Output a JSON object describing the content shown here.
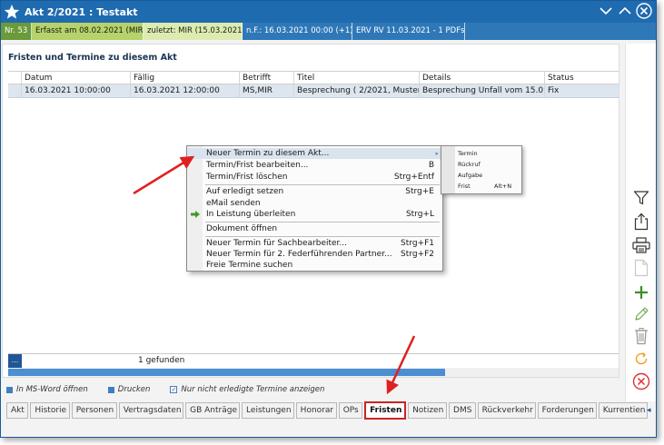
{
  "window": {
    "title": "Akt 2/2021 : Testakt"
  },
  "infobar": [
    {
      "text": "Nr. 53",
      "bg": "#6a9a3a",
      "fg": "#ffffff"
    },
    {
      "text": "Erfasst am 08.02.2021 (MIR)",
      "bg": "#b5d36a",
      "fg": "#1a1a1a"
    },
    {
      "text": "zuletzt: MIR (15.03.2021)",
      "bg": "#dcecb0",
      "fg": "#1a1a1a"
    },
    {
      "text": "n.F.: 16.03.2021 00:00 (+1)",
      "bg": "#2f78b8",
      "fg": "#ffffff"
    },
    {
      "text": "ERV RV 11.03.2021 - 1 PDFs",
      "bg": "#2f78b8",
      "fg": "#ffffff"
    }
  ],
  "section": {
    "title": "Fristen und Termine zu diesem Akt"
  },
  "grid": {
    "columns": [
      "Datum",
      "Fällig",
      "Betrifft",
      "Titel",
      "Details",
      "Status"
    ],
    "rows": [
      [
        "16.03.2021 10:00:00",
        "16.03.2021 12:00:00",
        "MS,MIR",
        "Besprechung ( 2/2021, Muster...",
        "Besprechung Unfall vom 15.0...",
        "Fix"
      ]
    ]
  },
  "footer": {
    "button": "...",
    "count": "1 gefunden"
  },
  "options": {
    "word": "In MS-Word öffnen",
    "print": "Drucken",
    "filter": "Nur nicht erledigte Termine anzeigen"
  },
  "tabs": [
    {
      "label": "Akt"
    },
    {
      "label": "Historie"
    },
    {
      "label": "Personen"
    },
    {
      "label": "Vertragsdaten"
    },
    {
      "label": "GB Anträge"
    },
    {
      "label": "Leistungen"
    },
    {
      "label": "Honorar"
    },
    {
      "label": "OPs"
    },
    {
      "label": "Fristen",
      "active": true
    },
    {
      "label": "Notizen"
    },
    {
      "label": "DMS"
    },
    {
      "label": "Rückverkehr"
    },
    {
      "label": "Forderungen"
    },
    {
      "label": "Kurrentien"
    }
  ],
  "tabs_arrow": "◂",
  "context_menu": {
    "items": [
      {
        "label": "Neuer Termin zu diesem Akt...",
        "key": "",
        "highlighted": true,
        "submenu": true
      },
      {
        "label": "Termin/Frist bearbeiten...",
        "key": "B"
      },
      {
        "label": "Termin/Frist löschen",
        "key": "Strg+Entf"
      },
      {
        "label": "Auf erledigt setzen",
        "key": "Strg+E"
      },
      {
        "label": "eMail senden",
        "key": ""
      },
      {
        "label": "In Leistung überleiten",
        "key": "Strg+L",
        "icon": "green-arrow-icon"
      },
      {
        "label": "Dokument öffnen",
        "key": ""
      },
      {
        "label": "Neuer Termin für Sachbearbeiter...",
        "key": "Strg+F1"
      },
      {
        "label": "Neuer Termin für 2. Federführenden Partner...",
        "key": "Strg+F2"
      },
      {
        "label": "Freie Termine suchen",
        "key": ""
      }
    ]
  },
  "submenu": {
    "items": [
      {
        "label": "Termin",
        "key": ""
      },
      {
        "label": "Rückruf",
        "key": ""
      },
      {
        "label": "Aufgabe",
        "key": ""
      },
      {
        "label": "Frist",
        "key": "Alt+N"
      }
    ]
  },
  "toolbar": {
    "icons": [
      "filter-icon",
      "share-icon",
      "print-icon",
      "document-icon",
      "add-icon",
      "edit-icon",
      "delete-icon",
      "refresh-icon",
      "close-circle-icon"
    ]
  },
  "colors": {
    "accent": "#1f6bb0",
    "annotation_red": "#e02020",
    "add_green": "#3c8c2a",
    "refresh_orange": "#f0a020",
    "close_red": "#e03030"
  }
}
